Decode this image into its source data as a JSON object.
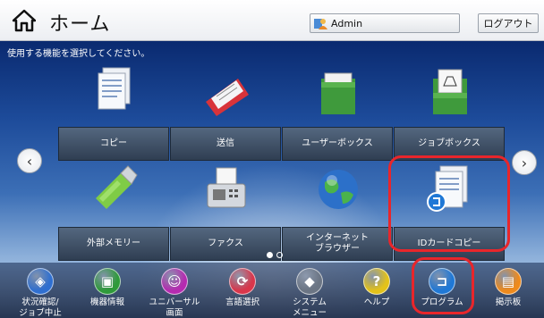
{
  "header": {
    "title": "ホーム",
    "user_label": "Admin",
    "logout_label": "ログアウト"
  },
  "main": {
    "instruction": "使用する機能を選択してください。"
  },
  "tiles": [
    {
      "label": "コピー",
      "icon": "copy-icon"
    },
    {
      "label": "送信",
      "icon": "send-icon"
    },
    {
      "label": "ユーザーボックス",
      "icon": "user-box-icon"
    },
    {
      "label": "ジョブボックス",
      "icon": "job-box-icon"
    },
    {
      "label": "外部メモリー",
      "icon": "usb-memory-icon"
    },
    {
      "label": "ファクス",
      "icon": "fax-icon"
    },
    {
      "label": "インターネット\nブラウザー",
      "icon": "globe-icon"
    },
    {
      "label": "IDカードコピー",
      "icon": "id-card-copy-icon"
    }
  ],
  "pager": {
    "current_page": 1,
    "page_count": 2
  },
  "dock": [
    {
      "label": "状況確認/\nジョブ中止",
      "icon": "status-icon",
      "color": "#2f6fd0",
      "glyph": "◈"
    },
    {
      "label": "機器情報",
      "icon": "device-info-icon",
      "color": "#2f9a3a",
      "glyph": "▣"
    },
    {
      "label": "ユニバーサル\n画面",
      "icon": "accessibility-icon",
      "color": "#b52bb0",
      "glyph": "☺"
    },
    {
      "label": "言語選択",
      "icon": "language-icon",
      "color": "#d9364b",
      "glyph": "⟳"
    },
    {
      "label": "システム\nメニュー",
      "icon": "system-menu-icon",
      "color": "#6b7584",
      "glyph": "◆"
    },
    {
      "label": "ヘルプ",
      "icon": "help-icon",
      "color": "#e3c21a",
      "glyph": "?"
    },
    {
      "label": "プログラム",
      "icon": "program-icon",
      "color": "#1f78d6",
      "glyph": "⊐"
    },
    {
      "label": "掲示板",
      "icon": "bulletin-board-icon",
      "color": "#ee8a1c",
      "glyph": "▤"
    }
  ],
  "colors": {
    "highlight": "#e8262b",
    "tile_bg": "#3c4d63"
  }
}
